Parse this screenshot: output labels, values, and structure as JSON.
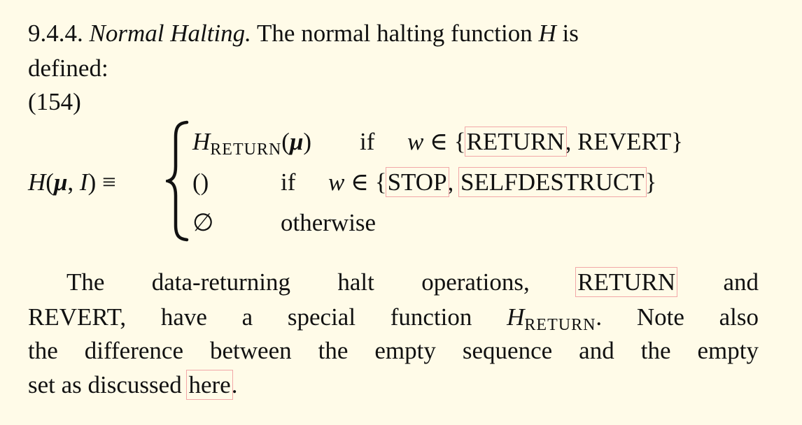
{
  "heading": {
    "number": "9.4.4.",
    "title": "Normal Halting.",
    "text": "The normal halting function",
    "symbol": "H",
    "tail": "is"
  },
  "intro_cont": "defined:",
  "equation_number": "(154)",
  "equation": {
    "lhs_H": "H",
    "lhs_open": "(",
    "lhs_mu": "μ",
    "lhs_sep": ", ",
    "lhs_I": "I",
    "lhs_close": ")",
    "equiv": "≡",
    "cases": [
      {
        "value_H": "H",
        "value_sub": "RETURN",
        "value_arg_open": "(",
        "value_arg": "μ",
        "value_arg_close": ")",
        "cond_if": "if",
        "cond_w": "w",
        "cond_in": "∈ {",
        "cond_item1": "RETURN",
        "cond_sep": ", ",
        "cond_item2": "REVERT",
        "cond_close": "}"
      },
      {
        "value": "()",
        "cond_if": "if",
        "cond_w": "w",
        "cond_in": "∈ {",
        "cond_item1": "STOP",
        "cond_sep": ", ",
        "cond_item2": "SELFDESTRUCT",
        "cond_close": "}"
      },
      {
        "value": "∅",
        "cond": "otherwise"
      }
    ]
  },
  "paragraph": {
    "l1_a": "The data-returning halt operations,",
    "l1_link": "RETURN",
    "l1_b": "and",
    "l2_a": "REVERT, have a special function",
    "l2_H": "H",
    "l2_sub": "RETURN",
    "l2_b": ".  Note also",
    "l3": "the difference between the empty sequence and the empty",
    "l4_a": "set as discussed",
    "l4_link": "here",
    "l4_b": "."
  },
  "colors": {
    "background": "#fffbe8",
    "text": "#111111",
    "link_box": "#f2a7a7"
  }
}
